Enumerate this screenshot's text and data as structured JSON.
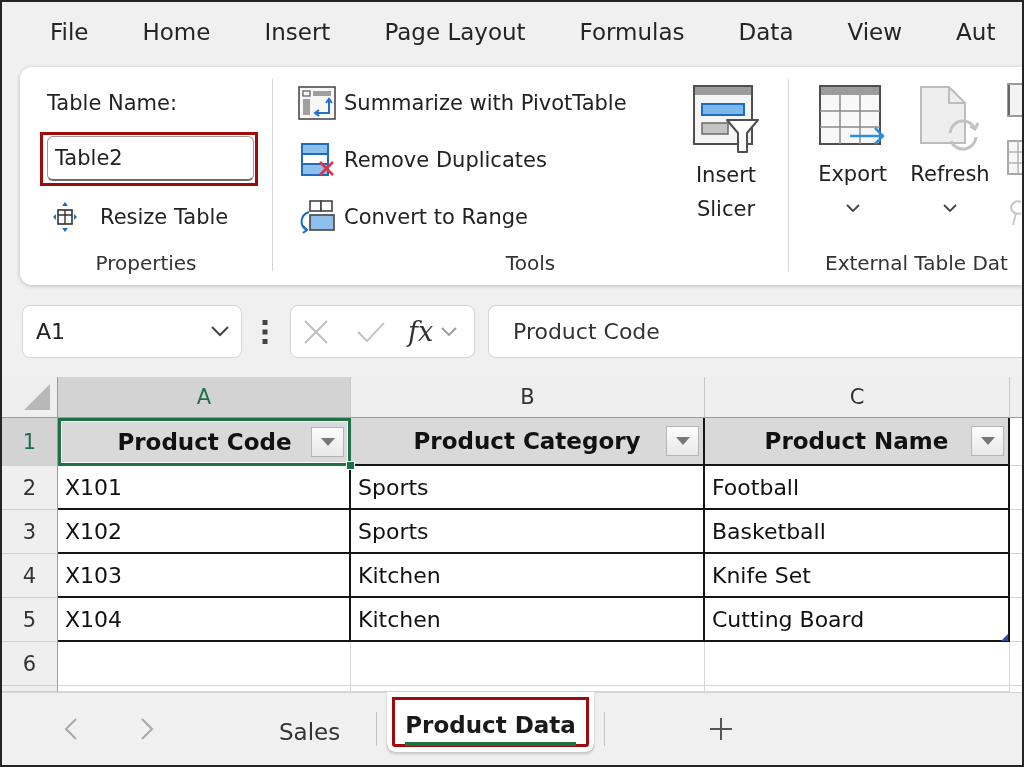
{
  "menu_tabs": [
    {
      "label": "File",
      "selected": false
    },
    {
      "label": "Home",
      "selected": false
    },
    {
      "label": "Insert",
      "selected": false
    },
    {
      "label": "Page Layout",
      "selected": false
    },
    {
      "label": "Formulas",
      "selected": false
    },
    {
      "label": "Data",
      "selected": false
    },
    {
      "label": "View",
      "selected": false
    },
    {
      "label": "Aut",
      "selected": false
    }
  ],
  "ribbon": {
    "groups": [
      {
        "kind": "properties",
        "field_label": "Table Name:",
        "field": {
          "value": "Table2",
          "highlighted": true
        },
        "buttons": [
          {
            "label": "Resize Table"
          }
        ],
        "label": "Properties"
      },
      {
        "kind": "tools",
        "buttons": [
          {
            "kind": "small",
            "label": "Summarize with PivotTable"
          },
          {
            "kind": "small",
            "label": "Remove Duplicates"
          },
          {
            "kind": "small",
            "label": "Convert to Range"
          },
          {
            "kind": "large",
            "label": "Insert Slicer"
          }
        ],
        "label": "Tools"
      },
      {
        "kind": "external",
        "buttons": [
          {
            "label": "Export",
            "dropdown": true
          },
          {
            "label": "Refresh",
            "dropdown": true
          }
        ],
        "label": "External Table Dat"
      }
    ]
  },
  "formula_bar": {
    "name_box": "A1",
    "function_button": "fx",
    "formula": "Product Code"
  },
  "sheet": {
    "columns": [
      {
        "letter": "A"
      },
      {
        "letter": "B"
      },
      {
        "letter": "C"
      }
    ],
    "header_row": {
      "number": "1",
      "cells": [
        {
          "text": "Product Code",
          "selected": true
        },
        {
          "text": "Product Category",
          "selected": false
        },
        {
          "text": "Product Name",
          "selected": false
        }
      ]
    },
    "rows": [
      {
        "number": "2",
        "cells": [
          {
            "text": "X101",
            "selected": false
          },
          {
            "text": "Sports",
            "selected": false
          },
          {
            "text": "Football",
            "selected": false
          }
        ]
      },
      {
        "number": "3",
        "cells": [
          {
            "text": "X102",
            "selected": false
          },
          {
            "text": "Sports",
            "selected": false
          },
          {
            "text": "Basketball",
            "selected": false
          }
        ]
      },
      {
        "number": "4",
        "cells": [
          {
            "text": "X103",
            "selected": false
          },
          {
            "text": "Kitchen",
            "selected": false
          },
          {
            "text": "Knife Set",
            "selected": false
          }
        ]
      },
      {
        "number": "5",
        "cells": [
          {
            "text": "X104",
            "selected": false
          },
          {
            "text": "Kitchen",
            "selected": false
          },
          {
            "text": "Cutting Board",
            "selected": false
          }
        ]
      },
      {
        "number": "6"
      }
    ]
  },
  "sheet_tabs": [
    {
      "label": "Sales",
      "selected": false,
      "highlighted": false
    },
    {
      "label": "Product Data",
      "selected": true,
      "highlighted": true
    }
  ]
}
